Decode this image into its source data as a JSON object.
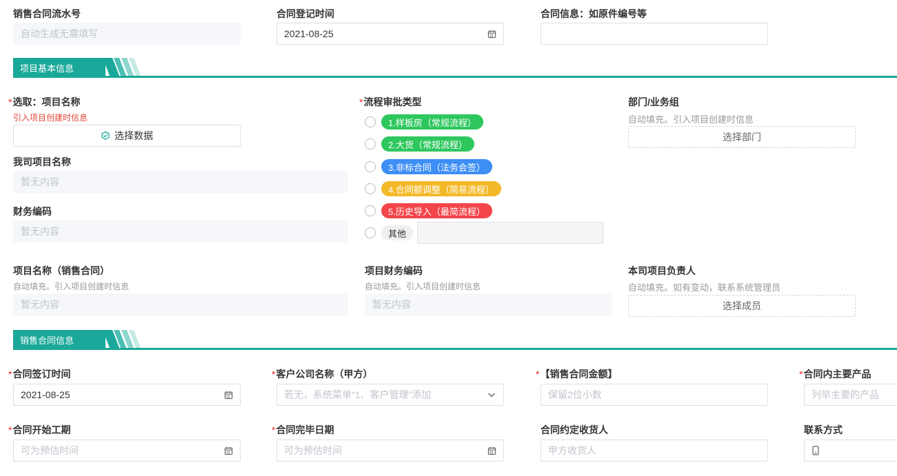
{
  "top": {
    "serial_label": "销售合同流水号",
    "serial_placeholder": "自动生成无需填写",
    "reg_time_label": "合同登记时间",
    "reg_time_value": "2021-08-25",
    "info_label": "合同信息：如原件编号等",
    "info_value": ""
  },
  "section1": {
    "title": "项目基本信息"
  },
  "project": {
    "select_label": "选取：项目名称",
    "select_hint": "引入项目创建时信息",
    "select_button": "选择数据",
    "our_name_label": "我司项目名称",
    "our_name_placeholder": "暂无内容",
    "finance_code_label": "财务编码",
    "finance_code_placeholder": "暂无内容",
    "sales_name_label": "项目名称（销售合同）",
    "sales_name_hint": "自动填充。引入项目创建时信息",
    "sales_name_placeholder": "暂无内容",
    "proj_finance_label": "项目财务编码",
    "proj_finance_hint": "自动填充。引入项目创建时信息",
    "proj_finance_placeholder": "暂无内容"
  },
  "flow": {
    "label": "流程审批类型",
    "options": [
      {
        "label": "1.样板房（常规流程）",
        "color": "#2ec75e"
      },
      {
        "label": "2.大货（常规流程）",
        "color": "#2ec75e"
      },
      {
        "label": "3.非标合同（法务会签）",
        "color": "#3d8ef5"
      },
      {
        "label": "4.合同额调整（简易流程）",
        "color": "#f3b928"
      },
      {
        "label": "5.历史导入（最简流程）",
        "color": "#f3454a"
      }
    ],
    "other_label": "其他",
    "other_value": ""
  },
  "dept": {
    "label": "部门/业务组",
    "hint": "自动填充。引入项目创建时信息",
    "button": "选择部门"
  },
  "owner": {
    "label": "本司项目负责人",
    "hint": "自动填充。如有变动，联系系统管理员",
    "button": "选择成员"
  },
  "section2": {
    "title": "销售合同信息"
  },
  "contract": {
    "sign_label": "合同签订时间",
    "sign_value": "2021-08-25",
    "customer_label": "客户公司名称（甲方）",
    "customer_placeholder": "若无，系统菜单“1、客户管理”添加",
    "amount_label": "【销售合同金额】",
    "amount_placeholder": "保留2位小数",
    "product_label": "合同内主要产品",
    "product_placeholder": "列举主要的产品",
    "start_label": "合同开始工期",
    "start_placeholder": "可为预估时间",
    "end_label": "合同完毕日期",
    "end_placeholder": "可为预估时间",
    "receiver_label": "合同约定收货人",
    "receiver_placeholder": "甲方收货人",
    "contact_label": "联系方式"
  },
  "colors": {
    "accent": "#1aa89a",
    "required": "#f5222d"
  },
  "icons": {
    "calendar": "calendar-icon",
    "chevron": "chevron-down-icon",
    "select": "select-data-icon",
    "phone": "phone-icon"
  }
}
